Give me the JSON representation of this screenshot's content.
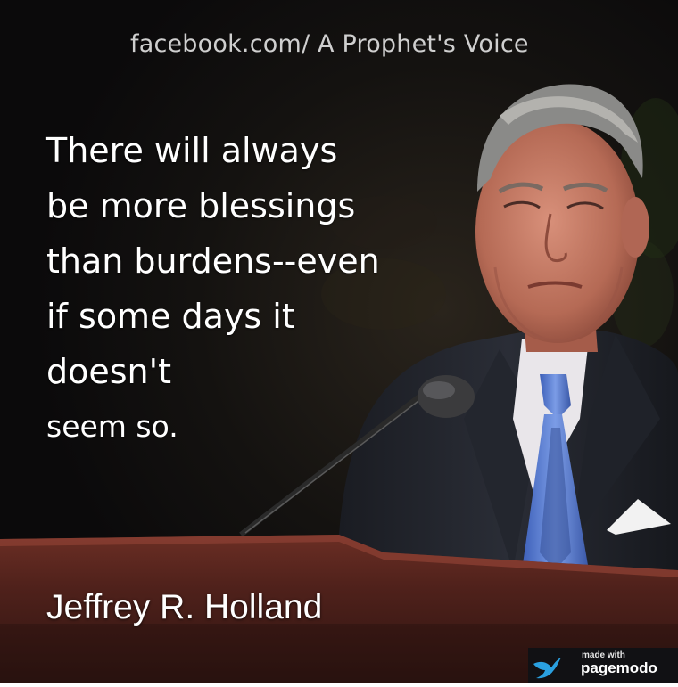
{
  "source_line": "facebook.com/ A Prophet's Voice",
  "quote": {
    "lines": [
      "There will always",
      "be more blessings",
      "than burdens--even",
      "if some days it",
      "doesn't",
      "seem so."
    ]
  },
  "author": "Jeffrey R. Holland",
  "watermark": {
    "small_text": "made with",
    "brand_text": "pagemodo",
    "icon": "pagemodo-bird-icon"
  },
  "colors": {
    "background": "#0d0c0e",
    "text": "#ffffff",
    "source_text": "#cfcfcf",
    "tie": "#5b7fd1",
    "podium": "#4a1f1a",
    "watermark_bird": "#2aa0e0"
  }
}
